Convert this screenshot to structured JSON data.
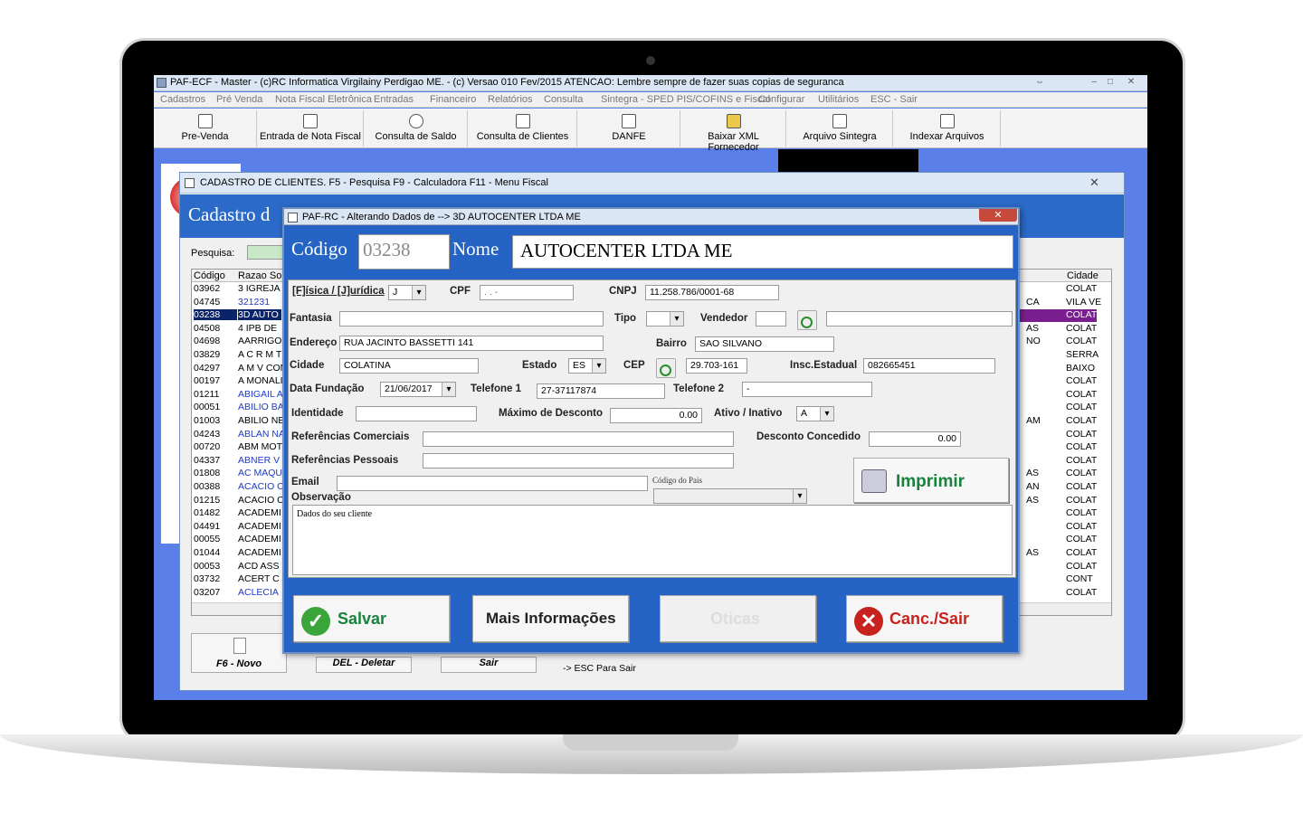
{
  "window": {
    "title": "PAF-ECF - Master - (c)RC Informatica Virgilainy Perdigao ME.  - (c) Versao 010 Fev/2015 ATENCAO: Lembre sempre de fazer suas copias de seguranca",
    "restore_glyph": "⇔",
    "min_glyph": "–",
    "max_glyph": "□",
    "close_glyph": "✕"
  },
  "menu": [
    "Cadastros",
    "Pré Venda",
    "Nota Fiscal Eletrônica",
    "Entradas",
    "Financeiro",
    "Relatórios",
    "Consulta",
    "Sintegra - SPED PIS/COFINS e Fiscal",
    "Configurar",
    "Utilitários",
    "ESC - Sair"
  ],
  "toolbar": [
    {
      "label": "Pre-Venda",
      "icon": "printer-icon"
    },
    {
      "label": "Entrada de Nota Fiscal",
      "icon": "document-icon"
    },
    {
      "label": "Consulta de Saldo",
      "icon": "search-icon"
    },
    {
      "label": "Consulta de Clientes",
      "icon": "search-document-icon"
    },
    {
      "label": "DANFE",
      "icon": "printer-icon"
    },
    {
      "label": "Baixar XML Fornecedor",
      "icon": "folder-icon"
    },
    {
      "label": "Arquivo Sintegra",
      "icon": "document-icon"
    },
    {
      "label": "Indexar Arquivos",
      "icon": "index-icon"
    }
  ],
  "cadastro": {
    "title": "CADASTRO DE CLIENTES. F5 - Pesquisa   F9 - Calculadora     F11 - Menu Fiscal",
    "header": "Cadastro d",
    "pesquisa_label": "Pesquisa:",
    "columns": {
      "codigo": "Código",
      "razao": "Razao So",
      "cidade": "Cidade"
    },
    "rows": [
      {
        "codigo": "03962",
        "razao": "3 IGREJA",
        "mid": "",
        "cidade": "COLAT"
      },
      {
        "codigo": "04745",
        "razao": "321231",
        "mid": "CA",
        "cidade": "VILA VE"
      },
      {
        "codigo": "03238",
        "razao": "3D AUTO",
        "mid": "",
        "cidade": "COLAT"
      },
      {
        "codigo": "04508",
        "razao": "4 IPB DE",
        "mid": "AS",
        "cidade": "COLAT"
      },
      {
        "codigo": "04698",
        "razao": "AARRIGO",
        "mid": "NO",
        "cidade": "COLAT"
      },
      {
        "codigo": "03829",
        "razao": "A C R M T",
        "mid": "",
        "cidade": "SERRA"
      },
      {
        "codigo": "04297",
        "razao": "A M V CON",
        "mid": "",
        "cidade": "BAIXO"
      },
      {
        "codigo": "00197",
        "razao": "A MONALI",
        "mid": "",
        "cidade": "COLAT"
      },
      {
        "codigo": "01211",
        "razao": "ABIGAIL A",
        "mid": "",
        "cidade": "COLAT"
      },
      {
        "codigo": "00051",
        "razao": "ABILIO BA",
        "mid": "",
        "cidade": "COLAT"
      },
      {
        "codigo": "01003",
        "razao": "ABILIO NE",
        "mid": "AM",
        "cidade": "COLAT"
      },
      {
        "codigo": "04243",
        "razao": "ABLAN NA",
        "mid": "",
        "cidade": "COLAT"
      },
      {
        "codigo": "00720",
        "razao": "ABM MOT",
        "mid": "",
        "cidade": "COLAT"
      },
      {
        "codigo": "04337",
        "razao": "ABNER V",
        "mid": "",
        "cidade": "COLAT"
      },
      {
        "codigo": "01808",
        "razao": "AC MAQU",
        "mid": "AS",
        "cidade": "COLAT"
      },
      {
        "codigo": "00388",
        "razao": "ACACIO C",
        "mid": "AN",
        "cidade": "COLAT"
      },
      {
        "codigo": "01215",
        "razao": "ACACIO C",
        "mid": "AS",
        "cidade": "COLAT"
      },
      {
        "codigo": "01482",
        "razao": "ACADEMI",
        "mid": "",
        "cidade": "COLAT"
      },
      {
        "codigo": "04491",
        "razao": "ACADEMI",
        "mid": "",
        "cidade": "COLAT"
      },
      {
        "codigo": "00055",
        "razao": "ACADEMI",
        "mid": "",
        "cidade": "COLAT"
      },
      {
        "codigo": "01044",
        "razao": "ACADEMI",
        "mid": "AS",
        "cidade": "COLAT"
      },
      {
        "codigo": "00053",
        "razao": "ACD ASS",
        "mid": "",
        "cidade": "COLAT"
      },
      {
        "codigo": "03732",
        "razao": "ACERT C",
        "mid": "",
        "cidade": "CONT"
      },
      {
        "codigo": "03207",
        "razao": "ACLECIA",
        "mid": "",
        "cidade": "COLAT"
      }
    ],
    "buttons": {
      "novo": "F6 - Novo",
      "deletar": "DEL - Deletar",
      "sair": "Sair",
      "esc_hint": "-> ESC Para Sair"
    }
  },
  "dialog": {
    "title": "PAF-RC - Alterando Dados de --> 3D AUTOCENTER LTDA ME",
    "codigo_label": "Código",
    "codigo_value": "03238",
    "nome_label": "Nome",
    "nome_value": "AUTOCENTER LTDA ME",
    "fj_label": "[F]ísica / [J]urídica",
    "fj_value": "J",
    "cpf_label": "CPF",
    "cpf_value": "   .   .   -",
    "cnpj_label": "CNPJ",
    "cnpj_value": "11.258.786/0001-68",
    "fantasia_label": "Fantasia",
    "fantasia_value": "",
    "tipo_label": "Tipo",
    "tipo_value": "",
    "vendedor_label": "Vendedor",
    "vendedor_code": "",
    "vendedor_name": "",
    "endereco_label": "Endereço",
    "endereco_value": "RUA JACINTO BASSETTI 141",
    "bairro_label": "Bairro",
    "bairro_value": "SAO SILVANO",
    "cidade_label": "Cidade",
    "cidade_value": "COLATINA",
    "estado_label": "Estado",
    "estado_value": "ES",
    "cep_label": "CEP",
    "cep_value": "29.703-161",
    "insc_label": "Insc.Estadual",
    "insc_value": "082665451",
    "data_label": "Data Fundação",
    "data_value": "21/06/2017",
    "tel1_label": "Telefone 1",
    "tel1_value": "27-37117874",
    "tel2_label": "Telefone 2",
    "tel2_value": "-",
    "identidade_label": "Identidade",
    "identidade_value": "",
    "maxdesc_label": "Máximo de Desconto",
    "maxdesc_value": "0.00",
    "ativo_label": "Ativo / Inativo",
    "ativo_value": "A",
    "refcom_label": "Referências Comerciais",
    "refcom_value": "",
    "desc_label": "Desconto Concedido",
    "desc_value": "0.00",
    "refpes_label": "Referências Pessoais",
    "refpes_value": "",
    "email_label": "Email",
    "email_value": "",
    "pais_label": "Código do Pais",
    "pais_value": "",
    "obs_label": "Observação",
    "obs_value": "Dados do seu cliente",
    "imprimir": "Imprimir",
    "salvar": "Salvar",
    "mais": "Mais Informações",
    "oticas": "Oticas",
    "canc": "Canc./Sair",
    "close_glyph": "✕",
    "zoom_tag": "F2"
  },
  "colors": {
    "accent": "#2563c4",
    "selected_row": "#0a246a",
    "purple_row": "#7a1f8f",
    "save_green": "#19823c",
    "cancel_red": "#c8221e"
  }
}
